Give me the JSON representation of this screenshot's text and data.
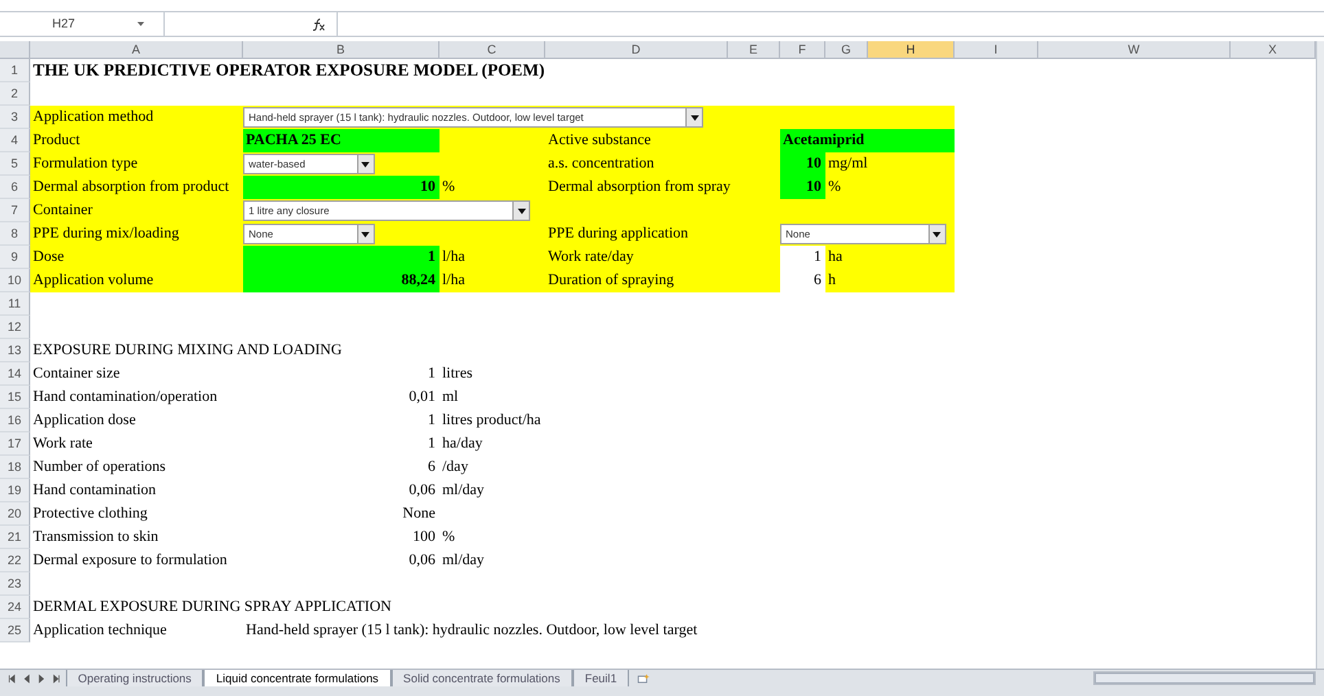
{
  "formula_bar": {
    "name_box": "H27"
  },
  "columns": [
    {
      "label": "A",
      "selected": false
    },
    {
      "label": "B",
      "selected": false
    },
    {
      "label": "C",
      "selected": false
    },
    {
      "label": "D",
      "selected": false
    },
    {
      "label": "E",
      "selected": false
    },
    {
      "label": "F",
      "selected": false
    },
    {
      "label": "G",
      "selected": false
    },
    {
      "label": "H",
      "selected": true
    },
    {
      "label": "I",
      "selected": false
    },
    {
      "label": "W",
      "selected": false
    },
    {
      "label": "X",
      "selected": false
    }
  ],
  "rows": [
    {
      "n": "1",
      "cells": {
        "A": {
          "kind": "title",
          "bold": true,
          "text": "THE UK PREDICTIVE OPERATOR EXPOSURE MODEL (POEM)"
        }
      }
    },
    {
      "n": "2",
      "cells": {}
    },
    {
      "n": "3",
      "color": "#ffff00",
      "cells": {
        "A": {
          "kind": "text",
          "text": "Application method"
        },
        "B": {
          "kind": "dropdown",
          "text": "Hand-held sprayer (15 l tank): hydraulic nozzles. Outdoor, low level target"
        }
      }
    },
    {
      "n": "4",
      "color": "#ffff00",
      "cells": {
        "A": {
          "kind": "text",
          "text": "Product"
        },
        "B": {
          "kind": "text",
          "bold": true,
          "color": "#00ff00",
          "text": "PACHA 25 EC"
        },
        "D": {
          "kind": "text",
          "text": "Active substance"
        },
        "F": {
          "kind": "text",
          "bold": true,
          "color": "#00ff00",
          "text": "Acetamiprid"
        }
      }
    },
    {
      "n": "5",
      "color": "#ffff00",
      "cells": {
        "A": {
          "kind": "text",
          "text": "Formulation type"
        },
        "B": {
          "kind": "dropdown",
          "text": "water-based"
        },
        "D": {
          "kind": "text",
          "text": "a.s. concentration"
        },
        "F": {
          "kind": "number",
          "bold": true,
          "color": "#00ff00",
          "text": "10"
        },
        "G": {
          "kind": "text",
          "text": "mg/ml"
        }
      }
    },
    {
      "n": "6",
      "color": "#ffff00",
      "cells": {
        "A": {
          "kind": "text",
          "text": "Dermal absorption from product"
        },
        "B": {
          "kind": "number",
          "bold": true,
          "color": "#00ff00",
          "text": "10"
        },
        "C": {
          "kind": "text",
          "text": "%"
        },
        "D": {
          "kind": "text",
          "text": "Dermal absorption from spray"
        },
        "F": {
          "kind": "number",
          "bold": true,
          "color": "#00ff00",
          "text": "10"
        },
        "G": {
          "kind": "text",
          "text": "%"
        }
      }
    },
    {
      "n": "7",
      "color": "#ffff00",
      "cells": {
        "A": {
          "kind": "text",
          "text": "Container"
        },
        "B": {
          "kind": "dropdown",
          "text": "1 litre any closure"
        }
      }
    },
    {
      "n": "8",
      "color": "#ffff00",
      "cells": {
        "A": {
          "kind": "text",
          "text": "PPE during mix/loading"
        },
        "B": {
          "kind": "dropdown",
          "text": "None"
        },
        "D": {
          "kind": "text",
          "text": "PPE during application"
        },
        "F": {
          "kind": "dropdown",
          "text": "None"
        }
      }
    },
    {
      "n": "9",
      "color": "#ffff00",
      "cells": {
        "A": {
          "kind": "text",
          "text": "Dose"
        },
        "B": {
          "kind": "number",
          "bold": true,
          "color": "#00ff00",
          "text": "1"
        },
        "C": {
          "kind": "text",
          "text": "l/ha"
        },
        "D": {
          "kind": "text",
          "text": "Work rate/day"
        },
        "F": {
          "kind": "number",
          "color": "#ffffff",
          "text": "1"
        },
        "G": {
          "kind": "text",
          "text": "ha"
        }
      }
    },
    {
      "n": "10",
      "color": "#ffff00",
      "cells": {
        "A": {
          "kind": "text",
          "text": "Application volume"
        },
        "B": {
          "kind": "number",
          "bold": true,
          "color": "#00ff00",
          "text": "88,24"
        },
        "C": {
          "kind": "text",
          "text": "l/ha"
        },
        "D": {
          "kind": "text",
          "text": "Duration of spraying"
        },
        "F": {
          "kind": "number",
          "color": "#ffffff",
          "text": "6"
        },
        "G": {
          "kind": "text",
          "text": "h"
        }
      }
    },
    {
      "n": "11",
      "cells": {}
    },
    {
      "n": "12",
      "cells": {}
    },
    {
      "n": "13",
      "cells": {
        "A": {
          "kind": "text",
          "text": "EXPOSURE DURING MIXING AND LOADING"
        }
      }
    },
    {
      "n": "14",
      "cells": {
        "A": {
          "kind": "text",
          "text": "Container size"
        },
        "B": {
          "kind": "number",
          "text": "1"
        },
        "C": {
          "kind": "text",
          "text": "litres"
        }
      }
    },
    {
      "n": "15",
      "cells": {
        "A": {
          "kind": "text",
          "text": "Hand contamination/operation"
        },
        "B": {
          "kind": "number",
          "text": "0,01"
        },
        "C": {
          "kind": "text",
          "text": "ml"
        }
      }
    },
    {
      "n": "16",
      "cells": {
        "A": {
          "kind": "text",
          "text": "Application dose"
        },
        "B": {
          "kind": "number",
          "text": "1"
        },
        "C": {
          "kind": "text",
          "text": "litres product/ha"
        }
      }
    },
    {
      "n": "17",
      "cells": {
        "A": {
          "kind": "text",
          "text": "Work rate"
        },
        "B": {
          "kind": "number",
          "text": "1"
        },
        "C": {
          "kind": "text",
          "text": "ha/day"
        }
      }
    },
    {
      "n": "18",
      "cells": {
        "A": {
          "kind": "text",
          "text": "Number of operations"
        },
        "B": {
          "kind": "number",
          "text": "6"
        },
        "C": {
          "kind": "text",
          "text": "/day"
        }
      }
    },
    {
      "n": "19",
      "cells": {
        "A": {
          "kind": "text",
          "text": "Hand contamination"
        },
        "B": {
          "kind": "number",
          "text": "0,06"
        },
        "C": {
          "kind": "text",
          "text": "ml/day"
        }
      }
    },
    {
      "n": "20",
      "cells": {
        "A": {
          "kind": "text",
          "text": "Protective clothing"
        },
        "B": {
          "kind": "number",
          "text": "None"
        }
      }
    },
    {
      "n": "21",
      "cells": {
        "A": {
          "kind": "text",
          "text": "Transmission to skin"
        },
        "B": {
          "kind": "number",
          "text": "100"
        },
        "C": {
          "kind": "text",
          "text": "%"
        }
      }
    },
    {
      "n": "22",
      "cells": {
        "A": {
          "kind": "text",
          "text": "Dermal exposure to formulation"
        },
        "B": {
          "kind": "number",
          "text": "0,06"
        },
        "C": {
          "kind": "text",
          "text": "ml/day"
        }
      }
    },
    {
      "n": "23",
      "cells": {}
    },
    {
      "n": "24",
      "cells": {
        "A": {
          "kind": "text",
          "text": "DERMAL EXPOSURE DURING SPRAY APPLICATION"
        }
      }
    },
    {
      "n": "25",
      "cells": {
        "A": {
          "kind": "text",
          "text": "Application technique"
        },
        "B": {
          "kind": "text",
          "text": "Hand-held sprayer (15 l tank): hydraulic nozzles. Outdoor, low level target"
        }
      }
    }
  ],
  "sheet_tabs": [
    {
      "label": "Operating instructions",
      "selected": false
    },
    {
      "label": "Liquid concentrate formulations",
      "selected": true
    },
    {
      "label": "Solid concentrate formulations",
      "selected": false
    },
    {
      "label": "Feuil1",
      "selected": false
    }
  ]
}
